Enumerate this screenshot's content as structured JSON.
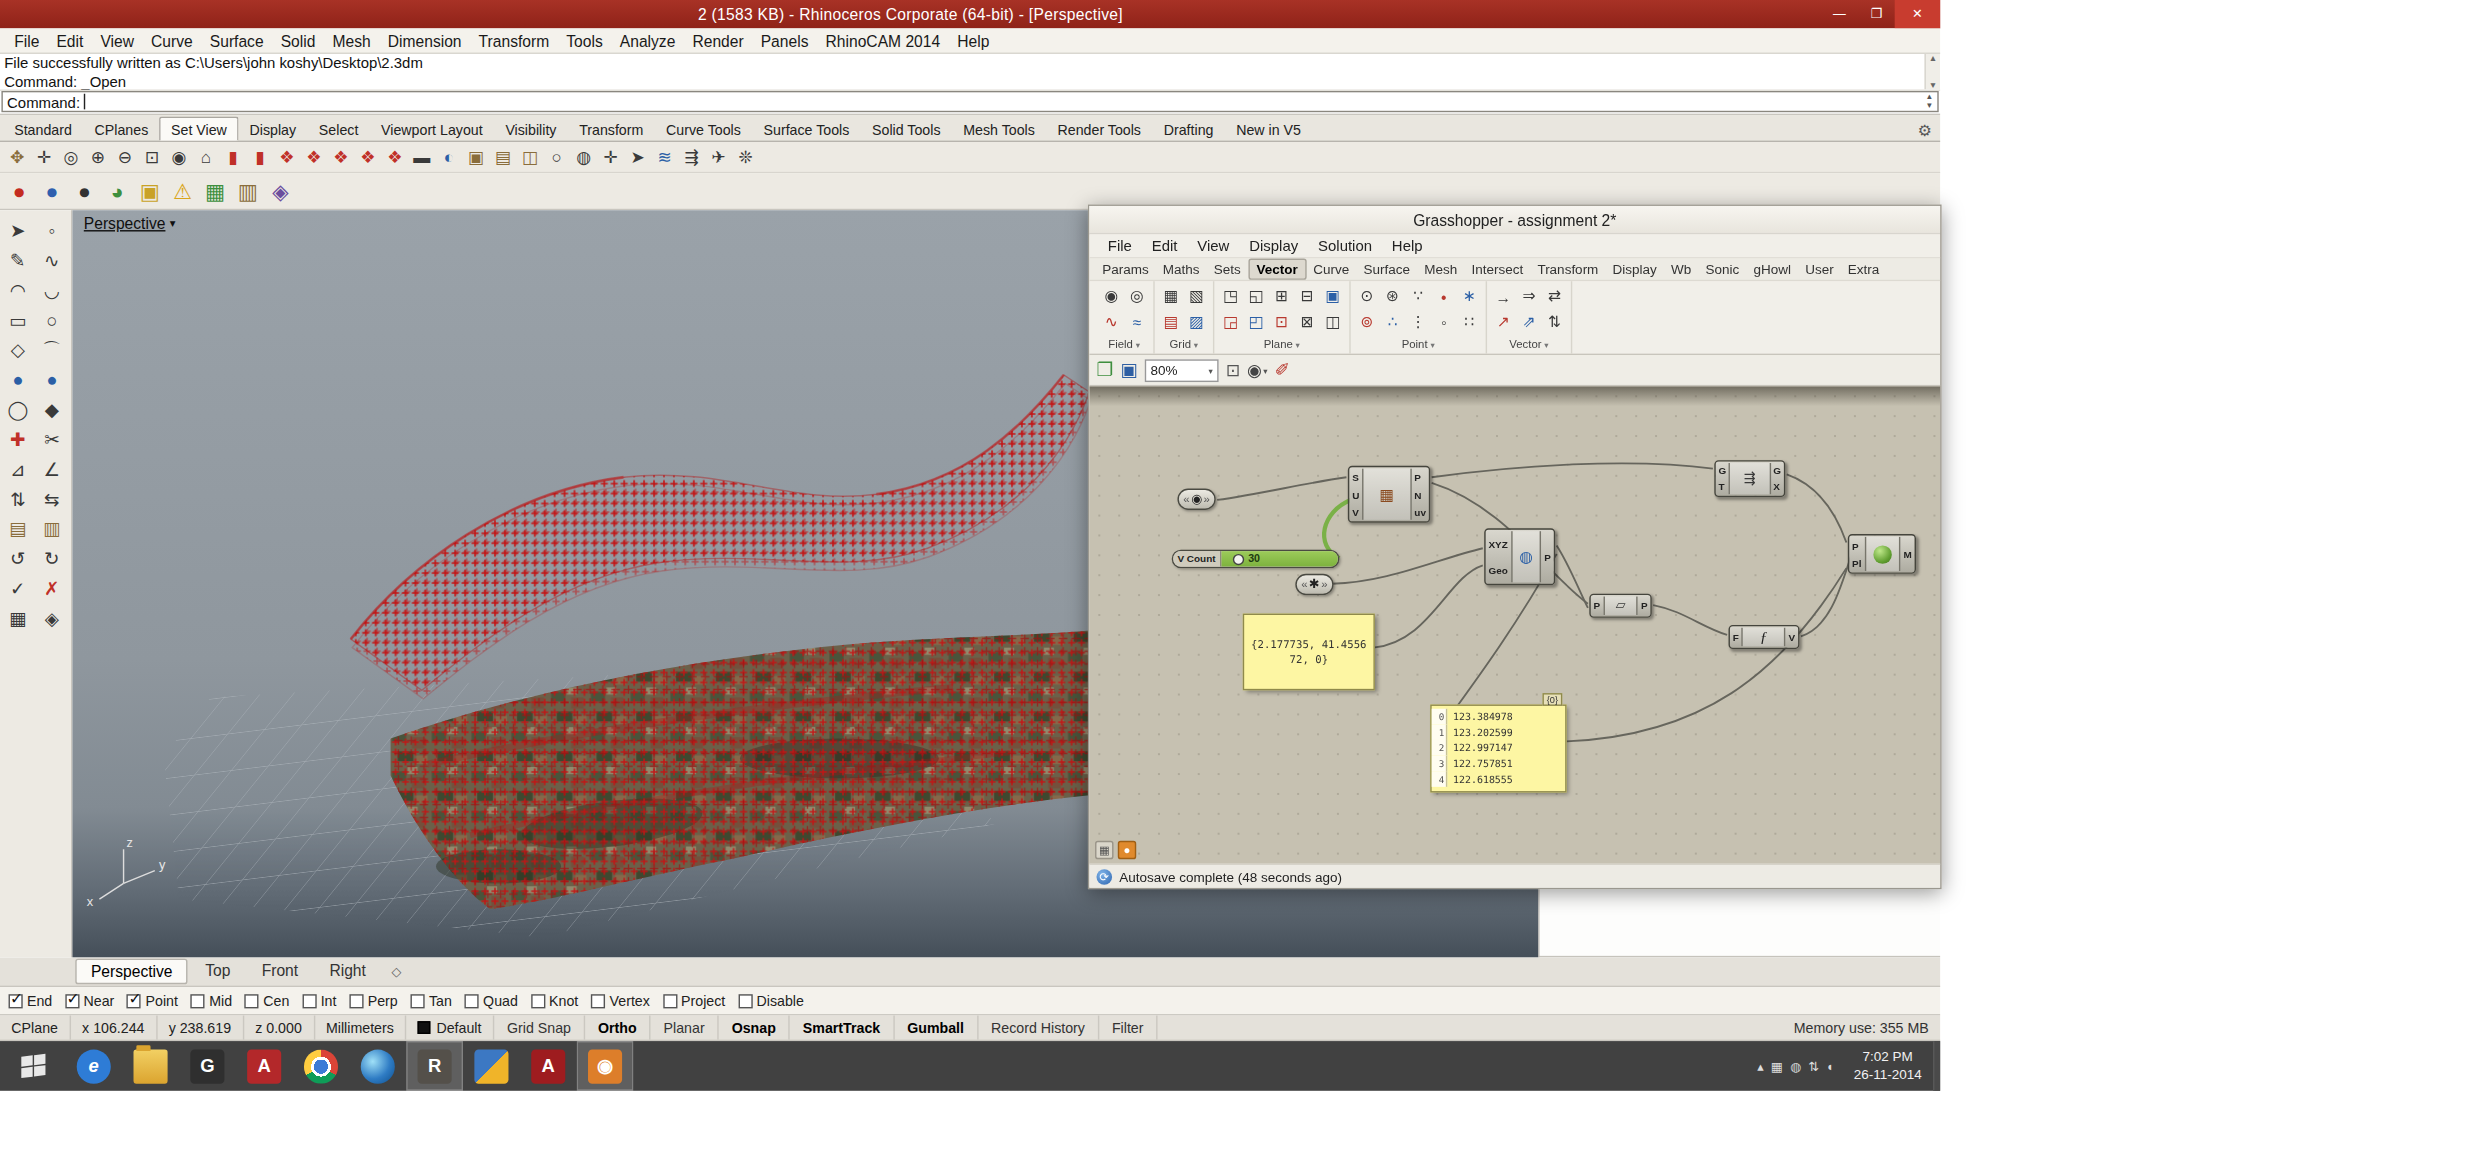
{
  "window": {
    "title": "2 (1583 KB) - Rhinoceros Corporate (64-bit) - [Perspective]",
    "controls": [
      {
        "g": "—",
        "n": "minimize-icon",
        "cls": ""
      },
      {
        "g": "❐",
        "n": "maximize-icon",
        "cls": ""
      },
      {
        "g": "✕",
        "n": "close-icon",
        "cls": "close"
      }
    ]
  },
  "menu": {
    "items": [
      {
        "label": "File"
      },
      {
        "label": "Edit"
      },
      {
        "label": "View"
      },
      {
        "label": "Curve"
      },
      {
        "label": "Surface"
      },
      {
        "label": "Solid"
      },
      {
        "label": "Mesh"
      },
      {
        "label": "Dimension"
      },
      {
        "label": "Transform"
      },
      {
        "label": "Tools"
      },
      {
        "label": "Analyze"
      },
      {
        "label": "Render"
      },
      {
        "label": "Panels"
      },
      {
        "label": "RhinoCAM 2014"
      },
      {
        "label": "Help"
      }
    ]
  },
  "command": {
    "history": [
      {
        "text": "File successfully written as C:\\Users\\john koshy\\Desktop\\2.3dm"
      },
      {
        "text": "Command: _Open"
      }
    ],
    "prompt": "Command:"
  },
  "tabbar": {
    "tabs": [
      {
        "label": "Standard",
        "cls": ""
      },
      {
        "label": "CPlanes",
        "cls": ""
      },
      {
        "label": "Set View",
        "cls": "active"
      },
      {
        "label": "Display",
        "cls": ""
      },
      {
        "label": "Select",
        "cls": ""
      },
      {
        "label": "Viewport Layout",
        "cls": ""
      },
      {
        "label": "Visibility",
        "cls": ""
      },
      {
        "label": "Transform",
        "cls": ""
      },
      {
        "label": "Curve Tools",
        "cls": ""
      },
      {
        "label": "Surface Tools",
        "cls": ""
      },
      {
        "label": "Solid Tools",
        "cls": ""
      },
      {
        "label": "Mesh Tools",
        "cls": ""
      },
      {
        "label": "Render Tools",
        "cls": ""
      },
      {
        "label": "Drafting",
        "cls": ""
      },
      {
        "label": "New in V5",
        "cls": ""
      }
    ]
  },
  "toolbar_main": {
    "icons": [
      {
        "g": "✥",
        "ic": "ti-tan",
        "n": "pan-icon"
      },
      {
        "g": "✛",
        "ic": "ti-dark",
        "n": "move-view-icon"
      },
      {
        "g": "◎",
        "ic": "ti-dark",
        "n": "zoom-icon"
      },
      {
        "g": "⊕",
        "ic": "ti-dark",
        "n": "zoom-in-icon"
      },
      {
        "g": "⊖",
        "ic": "ti-dark",
        "n": "zoom-out-icon"
      },
      {
        "g": "⊡",
        "ic": "ti-dark",
        "n": "zoom-window-icon"
      },
      {
        "g": "◉",
        "ic": "ti-dark",
        "n": "zoom-extents-icon"
      },
      {
        "g": "⌂",
        "ic": "ti-dark",
        "n": "home-view-icon"
      },
      {
        "g": "▮",
        "ic": "ti-red",
        "n": "named-view-icon"
      },
      {
        "g": "▮",
        "ic": "ti-red",
        "n": "named-view-icon"
      },
      {
        "g": "❖",
        "ic": "ti-red",
        "n": "walkabout-view-icon"
      },
      {
        "g": "❖",
        "ic": "ti-red",
        "n": "walkabout-view-icon"
      },
      {
        "g": "❖",
        "ic": "ti-red",
        "n": "walkabout-view-icon"
      },
      {
        "g": "❖",
        "ic": "ti-red",
        "n": "walkabout-view-icon"
      },
      {
        "g": "❖",
        "ic": "ti-red",
        "n": "walkabout-view-icon"
      },
      {
        "g": "▬",
        "ic": "ti-dark",
        "n": "separator-icon"
      },
      {
        "g": "◐",
        "ic": "ti-blue",
        "n": "camera-icon"
      },
      {
        "g": "▣",
        "ic": "ti-tan",
        "n": "viewport-properties-icon"
      },
      {
        "g": "▤",
        "ic": "ti-tan",
        "n": "viewport-layout-icon"
      },
      {
        "g": "◫",
        "ic": "ti-tan",
        "n": "split-viewport-icon"
      },
      {
        "g": "○",
        "ic": "ti-dark",
        "n": "spotlight-icon"
      },
      {
        "g": "◍",
        "ic": "ti-dark",
        "n": "shaded-view-icon"
      },
      {
        "g": "✛",
        "ic": "ti-dark",
        "n": "crosshair-icon"
      },
      {
        "g": "➤",
        "ic": "ti-dark",
        "n": "set-view-icon"
      },
      {
        "g": "≋",
        "ic": "ti-blue",
        "n": "background-icon"
      },
      {
        "g": "⇶",
        "ic": "ti-dark",
        "n": "synchronize-views-icon"
      },
      {
        "g": "✈",
        "ic": "ti-dark",
        "n": "fly-view-icon"
      },
      {
        "g": "❊",
        "ic": "ti-dark",
        "n": "refresh-view-icon"
      }
    ]
  },
  "toolbar_second": {
    "icons": [
      {
        "g": "●",
        "ic": "t2-red",
        "n": "render-sphere-red-icon"
      },
      {
        "g": "●",
        "ic": "t2-blue",
        "n": "render-sphere-blue-icon"
      },
      {
        "g": "●",
        "ic": "t2-dark",
        "n": "render-sphere-dark-icon"
      },
      {
        "g": "◕",
        "ic": "t2-green",
        "n": "earth-anchor-icon"
      },
      {
        "g": "▣",
        "ic": "t2-yellow",
        "n": "material-editor-icon"
      },
      {
        "g": "⚠",
        "ic": "t2-warn",
        "n": "sun-settings-icon"
      },
      {
        "g": "▦",
        "ic": "t2-green",
        "n": "ground-plane-icon"
      },
      {
        "g": "▥",
        "ic": "t2-tan",
        "n": "notes-icon"
      },
      {
        "g": "◈",
        "ic": "t2-violet",
        "n": "environment-icon"
      }
    ]
  },
  "sidebar": {
    "icons": [
      {
        "g": "➤",
        "ic": "sb-dark",
        "n": "select-icon"
      },
      {
        "g": "◦",
        "ic": "sb-dark",
        "n": "point-icon"
      },
      {
        "g": "✎",
        "ic": "sb-dark",
        "n": "curve-icon"
      },
      {
        "g": "∿",
        "ic": "sb-dark",
        "n": "freeform-curve-icon"
      },
      {
        "g": "◠",
        "ic": "sb-dark",
        "n": "arc-icon"
      },
      {
        "g": "◡",
        "ic": "sb-dark",
        "n": "arc-alt-icon"
      },
      {
        "g": "▭",
        "ic": "sb-dark",
        "n": "rectangle-icon"
      },
      {
        "g": "○",
        "ic": "sb-dark",
        "n": "circle-icon"
      },
      {
        "g": "◇",
        "ic": "sb-dark",
        "n": "polygon-icon"
      },
      {
        "g": "⌒",
        "ic": "sb-dark",
        "n": "ellipse-icon"
      },
      {
        "g": "●",
        "ic": "sb-blue",
        "n": "sphere-icon"
      },
      {
        "g": "●",
        "ic": "sb-blue",
        "n": "solid-tools-icon"
      },
      {
        "g": "◯",
        "ic": "sb-dark",
        "n": "cylinder-icon"
      },
      {
        "g": "◆",
        "ic": "sb-dark",
        "n": "box-icon"
      },
      {
        "g": "✚",
        "ic": "sb-red",
        "n": "boolean-icon"
      },
      {
        "g": "✂",
        "ic": "sb-dark",
        "n": "trim-icon"
      },
      {
        "g": "⊿",
        "ic": "sb-dark",
        "n": "fillet-icon"
      },
      {
        "g": "∠",
        "ic": "sb-dark",
        "n": "chamfer-icon"
      },
      {
        "g": "⇅",
        "ic": "sb-dark",
        "n": "offset-icon"
      },
      {
        "g": "⇆",
        "ic": "sb-dark",
        "n": "mirror-icon"
      },
      {
        "g": "▤",
        "ic": "sb-tan",
        "n": "surface-tools-icon"
      },
      {
        "g": "▥",
        "ic": "sb-tan",
        "n": "mesh-tools-icon"
      },
      {
        "g": "↺",
        "ic": "sb-dark",
        "n": "rotate-icon"
      },
      {
        "g": "↻",
        "ic": "sb-dark",
        "n": "rotate-3d-icon"
      },
      {
        "g": "✓",
        "ic": "sb-dark",
        "n": "analyze-icon"
      },
      {
        "g": "✗",
        "ic": "sb-red",
        "n": "delete-icon"
      },
      {
        "g": "▦",
        "ic": "sb-dark",
        "n": "array-icon"
      },
      {
        "g": "◈",
        "ic": "sb-dark",
        "n": "gumball-icon"
      }
    ]
  },
  "viewport": {
    "label": "Perspective",
    "axis": {
      "x": "x",
      "y": "y",
      "z": "z"
    },
    "tabs": [
      {
        "label": "Perspective",
        "cls": "active"
      },
      {
        "label": "Top",
        "cls": ""
      },
      {
        "label": "Front",
        "cls": ""
      },
      {
        "label": "Right",
        "cls": ""
      }
    ]
  },
  "osnap": {
    "items": [
      {
        "label": "End",
        "cls": "checked"
      },
      {
        "label": "Near",
        "cls": "checked"
      },
      {
        "label": "Point",
        "cls": "checked"
      },
      {
        "label": "Mid",
        "cls": ""
      },
      {
        "label": "Cen",
        "cls": ""
      },
      {
        "label": "Int",
        "cls": ""
      },
      {
        "label": "Perp",
        "cls": ""
      },
      {
        "label": "Tan",
        "cls": ""
      },
      {
        "label": "Quad",
        "cls": ""
      },
      {
        "label": "Knot",
        "cls": ""
      },
      {
        "label": "Vertex",
        "cls": ""
      },
      {
        "label": "Project",
        "cls": ""
      },
      {
        "label": "Disable",
        "cls": ""
      }
    ]
  },
  "statusbar": {
    "cplane": "CPlane",
    "x": "x 106.244",
    "y": "y 238.619",
    "z": "z 0.000",
    "units": "Millimeters",
    "layer": "Default",
    "memory": "Memory use: 355 MB",
    "toggles": [
      {
        "label": "Grid Snap",
        "cls": ""
      },
      {
        "label": "Ortho",
        "cls": "on"
      },
      {
        "label": "Planar",
        "cls": ""
      },
      {
        "label": "Osnap",
        "cls": "on"
      },
      {
        "label": "SmartTrack",
        "cls": "on"
      },
      {
        "label": "Gumball",
        "cls": "on"
      },
      {
        "label": "Record History",
        "cls": ""
      },
      {
        "label": "Filter",
        "cls": ""
      }
    ]
  },
  "gh": {
    "title": "Grasshopper - assignment 2*",
    "menu": [
      {
        "label": "File"
      },
      {
        "label": "Edit"
      },
      {
        "label": "View"
      },
      {
        "label": "Display"
      },
      {
        "label": "Solution"
      },
      {
        "label": "Help"
      }
    ],
    "tabs": [
      {
        "label": "Params",
        "cls": ""
      },
      {
        "label": "Maths",
        "cls": ""
      },
      {
        "label": "Sets",
        "cls": ""
      },
      {
        "label": "Vector",
        "cls": "active"
      },
      {
        "label": "Curve",
        "cls": ""
      },
      {
        "label": "Surface",
        "cls": ""
      },
      {
        "label": "Mesh",
        "cls": ""
      },
      {
        "label": "Intersect",
        "cls": ""
      },
      {
        "label": "Transform",
        "cls": ""
      },
      {
        "label": "Display",
        "cls": ""
      },
      {
        "label": "Wb",
        "cls": ""
      },
      {
        "label": "Sonic",
        "cls": ""
      },
      {
        "label": "gHowl",
        "cls": ""
      },
      {
        "label": "User",
        "cls": ""
      },
      {
        "label": "Extra",
        "cls": ""
      }
    ],
    "groups": {
      "field": {
        "label": "Field",
        "icons": [
          {
            "g": "◉",
            "ic": "gi-dark",
            "n": "field-point-charge-icon"
          },
          {
            "g": "∿",
            "ic": "gi-red",
            "n": "field-line-charge-icon"
          },
          {
            "g": "◎",
            "ic": "gi-dark",
            "n": "field-spin-icon"
          },
          {
            "g": "≈",
            "ic": "gi-blue",
            "n": "field-merge-icon"
          }
        ]
      },
      "grid": {
        "label": "Grid",
        "icons": [
          {
            "g": "▦",
            "ic": "gi-dark",
            "n": "square-grid-icon"
          },
          {
            "g": "▤",
            "ic": "gi-red",
            "n": "radial-grid-icon"
          },
          {
            "g": "▧",
            "ic": "gi-dark",
            "n": "triangular-grid-icon"
          },
          {
            "g": "▨",
            "ic": "gi-blue",
            "n": "hexagonal-grid-icon"
          }
        ]
      },
      "plane": {
        "label": "Plane",
        "icons": [
          {
            "g": "◳",
            "ic": "gi-dark",
            "n": "xy-plane-icon"
          },
          {
            "g": "◲",
            "ic": "gi-red",
            "n": "xz-plane-icon"
          },
          {
            "g": "◱",
            "ic": "gi-dark",
            "n": "yz-plane-icon"
          },
          {
            "g": "◰",
            "ic": "gi-blue",
            "n": "plane-3pt-icon"
          },
          {
            "g": "⊞",
            "ic": "gi-dark",
            "n": "plane-fit-icon"
          },
          {
            "g": "⊡",
            "ic": "gi-red",
            "n": "plane-origin-icon"
          },
          {
            "g": "⊟",
            "ic": "gi-dark",
            "n": "plane-offset-icon"
          },
          {
            "g": "⊠",
            "ic": "gi-dark",
            "n": "plane-align-icon"
          },
          {
            "g": "▣",
            "ic": "gi-blue",
            "n": "plane-rotate-icon"
          },
          {
            "g": "◫",
            "ic": "gi-dark",
            "n": "plane-flip-icon"
          }
        ]
      },
      "point": {
        "label": "Point",
        "icons": [
          {
            "g": "⊙",
            "ic": "gi-dark",
            "n": "construct-point-icon"
          },
          {
            "g": "⊚",
            "ic": "gi-red",
            "n": "deconstruct-point-icon"
          },
          {
            "g": "⊛",
            "ic": "gi-dark",
            "n": "point-polar-icon"
          },
          {
            "g": "∴",
            "ic": "gi-blue",
            "n": "point-cloud-icon"
          },
          {
            "g": "∵",
            "ic": "gi-dark",
            "n": "closest-point-icon"
          },
          {
            "g": "⋮",
            "ic": "gi-dark",
            "n": "sort-points-icon"
          },
          {
            "g": "•",
            "ic": "gi-red",
            "n": "point-param-icon"
          },
          {
            "g": "◦",
            "ic": "gi-dark",
            "n": "point-list-icon"
          },
          {
            "g": "∗",
            "ic": "gi-blue",
            "n": "populate-points-icon"
          },
          {
            "g": "∷",
            "ic": "gi-dark",
            "n": "point-groups-icon"
          }
        ]
      },
      "vector": {
        "label": "Vector",
        "icons": [
          {
            "g": "→",
            "ic": "gi-dark",
            "n": "vector-xyz-icon"
          },
          {
            "g": "↗",
            "ic": "gi-red",
            "n": "unit-vector-icon"
          },
          {
            "g": "⇒",
            "ic": "gi-dark",
            "n": "vector-2pt-icon"
          },
          {
            "g": "⇗",
            "ic": "gi-blue",
            "n": "vector-length-icon"
          },
          {
            "g": "⇄",
            "ic": "gi-dark",
            "n": "reverse-vector-icon"
          },
          {
            "g": "⇅",
            "ic": "gi-dark",
            "n": "vector-display-icon"
          }
        ]
      }
    },
    "zoom": "80%",
    "status": "Autosave complete (48 seconds ago)",
    "canvas": {
      "param_a": {
        "icon": "◉"
      },
      "param_b": {
        "icon": "✱"
      },
      "slider": {
        "label": "V Count",
        "value": "30"
      },
      "panel_point": {
        "line1": "{2.177735, 41.4556",
        "line2": "72, 0}"
      },
      "surface": {
        "inputs": [
          "S",
          "U",
          "V"
        ],
        "outputs": [
          "P",
          "N",
          "uv"
        ]
      },
      "xyz": {
        "inputs": [
          "XYZ",
          "Geo"
        ],
        "outputs": [
          "P"
        ]
      },
      "graft": {
        "inputs": [
          "G",
          "T"
        ],
        "outputs": [
          "G",
          "X"
        ]
      },
      "project": {
        "inputs": [
          "P"
        ],
        "outputs": [
          "P"
        ]
      },
      "evaluate": {
        "inputs": [
          "F"
        ],
        "outputs": [
          "V"
        ],
        "icon": "ƒ"
      },
      "mesh": {
        "inputs": [
          "P",
          "Pl"
        ],
        "outputs": [
          "M"
        ]
      },
      "panel_list": {
        "badge": "{0}",
        "rows": [
          {
            "i": "0",
            "v": "123.384978"
          },
          {
            "i": "1",
            "v": "123.202599"
          },
          {
            "i": "2",
            "v": "122.997147"
          },
          {
            "i": "3",
            "v": "122.757851"
          },
          {
            "i": "4",
            "v": "122.618555"
          }
        ]
      }
    }
  },
  "taskbar": {
    "icons": [
      {
        "g": "e",
        "ic": "tb-ie",
        "cls": "",
        "n": "internet-explorer-icon"
      },
      {
        "g": "",
        "ic": "tb-folder",
        "cls": "",
        "n": "file-explorer-icon"
      },
      {
        "g": "G",
        "ic": "tb-dark",
        "cls": "",
        "n": "g-app-icon"
      },
      {
        "g": "A",
        "ic": "tb-reda",
        "cls": "",
        "n": "red-a-app-icon"
      },
      {
        "g": "",
        "ic": "tb-chrome",
        "cls": "",
        "n": "chrome-icon"
      },
      {
        "g": "",
        "ic": "tb-earth",
        "cls": "",
        "n": "google-earth-icon"
      },
      {
        "g": "R",
        "ic": "tb-rhino",
        "cls": "active",
        "n": "rhino-app-icon"
      },
      {
        "g": "",
        "ic": "tb-multi",
        "cls": "",
        "n": "app-icon"
      },
      {
        "g": "A",
        "ic": "tb-adobe",
        "cls": "",
        "n": "adobe-reader-icon"
      },
      {
        "g": "◉",
        "ic": "tb-orange",
        "cls": "active",
        "n": "orange-app-icon"
      }
    ],
    "tray": [
      {
        "g": "▴",
        "n": "tray-chevron-icon"
      },
      {
        "g": "▦",
        "n": "tray-app-icon"
      },
      {
        "g": "◍",
        "n": "tray-network-icon"
      },
      {
        "g": "⇅",
        "n": "tray-activity-icon"
      },
      {
        "g": "◖",
        "n": "tray-volume-icon"
      }
    ],
    "clock": {
      "time": "7:02 PM",
      "date": "26-11-2014"
    }
  }
}
